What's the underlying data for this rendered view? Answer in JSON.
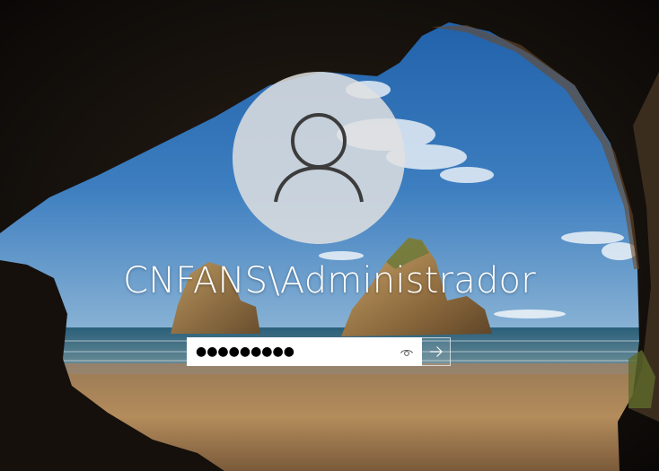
{
  "user": {
    "display_name": "CNFANS\\Administrador"
  },
  "password": {
    "masked_value": "●●●●●●●●●",
    "reveal_icon": "eye-icon",
    "submit_icon": "arrow-right-icon"
  },
  "theme": {
    "avatar_bg": "#e1e1e1",
    "avatar_glyph": "#3c3c3c",
    "text_color": "#ffffff"
  }
}
